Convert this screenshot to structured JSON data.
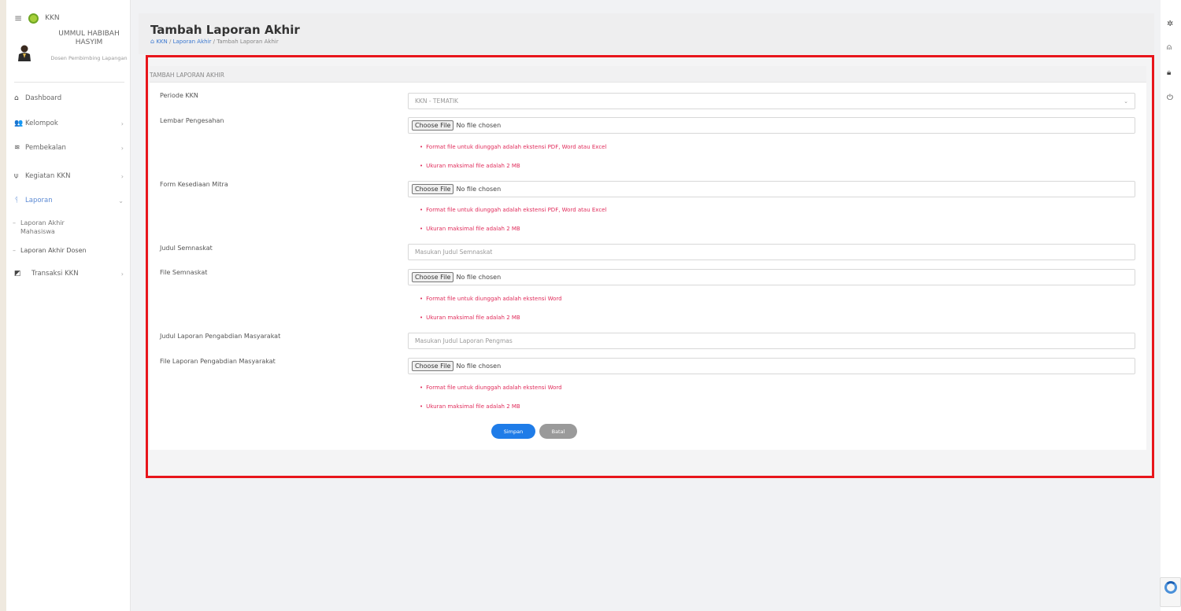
{
  "app": {
    "name": "KKN"
  },
  "user": {
    "name": "UMMUL HABIBAH HASYIM",
    "role": "Dosen Pembimbing Lapangan"
  },
  "sidebar": {
    "items": [
      {
        "label": "Dashboard",
        "icon": "home-icon"
      },
      {
        "label": "Kelompok",
        "icon": "users-icon"
      },
      {
        "label": "Pembekalan",
        "icon": "layers-icon"
      },
      {
        "label": "Kegiatan KKN",
        "icon": "activity-icon"
      },
      {
        "label": "Laporan",
        "icon": "report-icon"
      },
      {
        "label": "Transaksi KKN",
        "icon": "cube-icon"
      }
    ],
    "sub_items": [
      {
        "label": "Laporan Akhir Mahasiswa"
      },
      {
        "label": "Laporan Akhir Dosen"
      }
    ]
  },
  "header": {
    "title": "Tambah Laporan Akhir",
    "breadcrumb": [
      "KKN",
      "Laporan Akhir",
      "Tambah Laporan Akhir"
    ]
  },
  "form": {
    "card_title": "TAMBAH LAPORAN AKHIR",
    "periode_label": "Periode KKN",
    "periode_value": "KKN - TEMATIK",
    "file_button": "Choose File",
    "no_file": "No file chosen",
    "lembar_label": "Lembar Pengesahan",
    "mitra_label": "Form Kesediaan Mitra",
    "judul_semnaskat_label": "Judul Semnaskat",
    "judul_semnaskat_placeholder": "Masukan Judul Semnaskat",
    "file_semnaskat_label": "File Semnaskat",
    "judul_pengmas_label": "Judul Laporan Pengabdian Masyarakat",
    "judul_pengmas_placeholder": "Masukan Judul Laporan Pengmas",
    "file_pengmas_label": "File Laporan Pengabdian Masyarakat",
    "note_format_excel": "Format file untuk diunggah adalah ekstensi PDF, Word atau Excel",
    "note_format_word": "Format file untuk diunggah adalah ekstensi Word",
    "note_size": "Ukuran maksimal file adalah 2 MB",
    "save_label": "Simpan",
    "cancel_label": "Batal"
  },
  "colors": {
    "accent": "#1f7ce8",
    "highlight_border": "#e8151b",
    "note": "#e02c5b",
    "logo": "#a6cf3a"
  }
}
